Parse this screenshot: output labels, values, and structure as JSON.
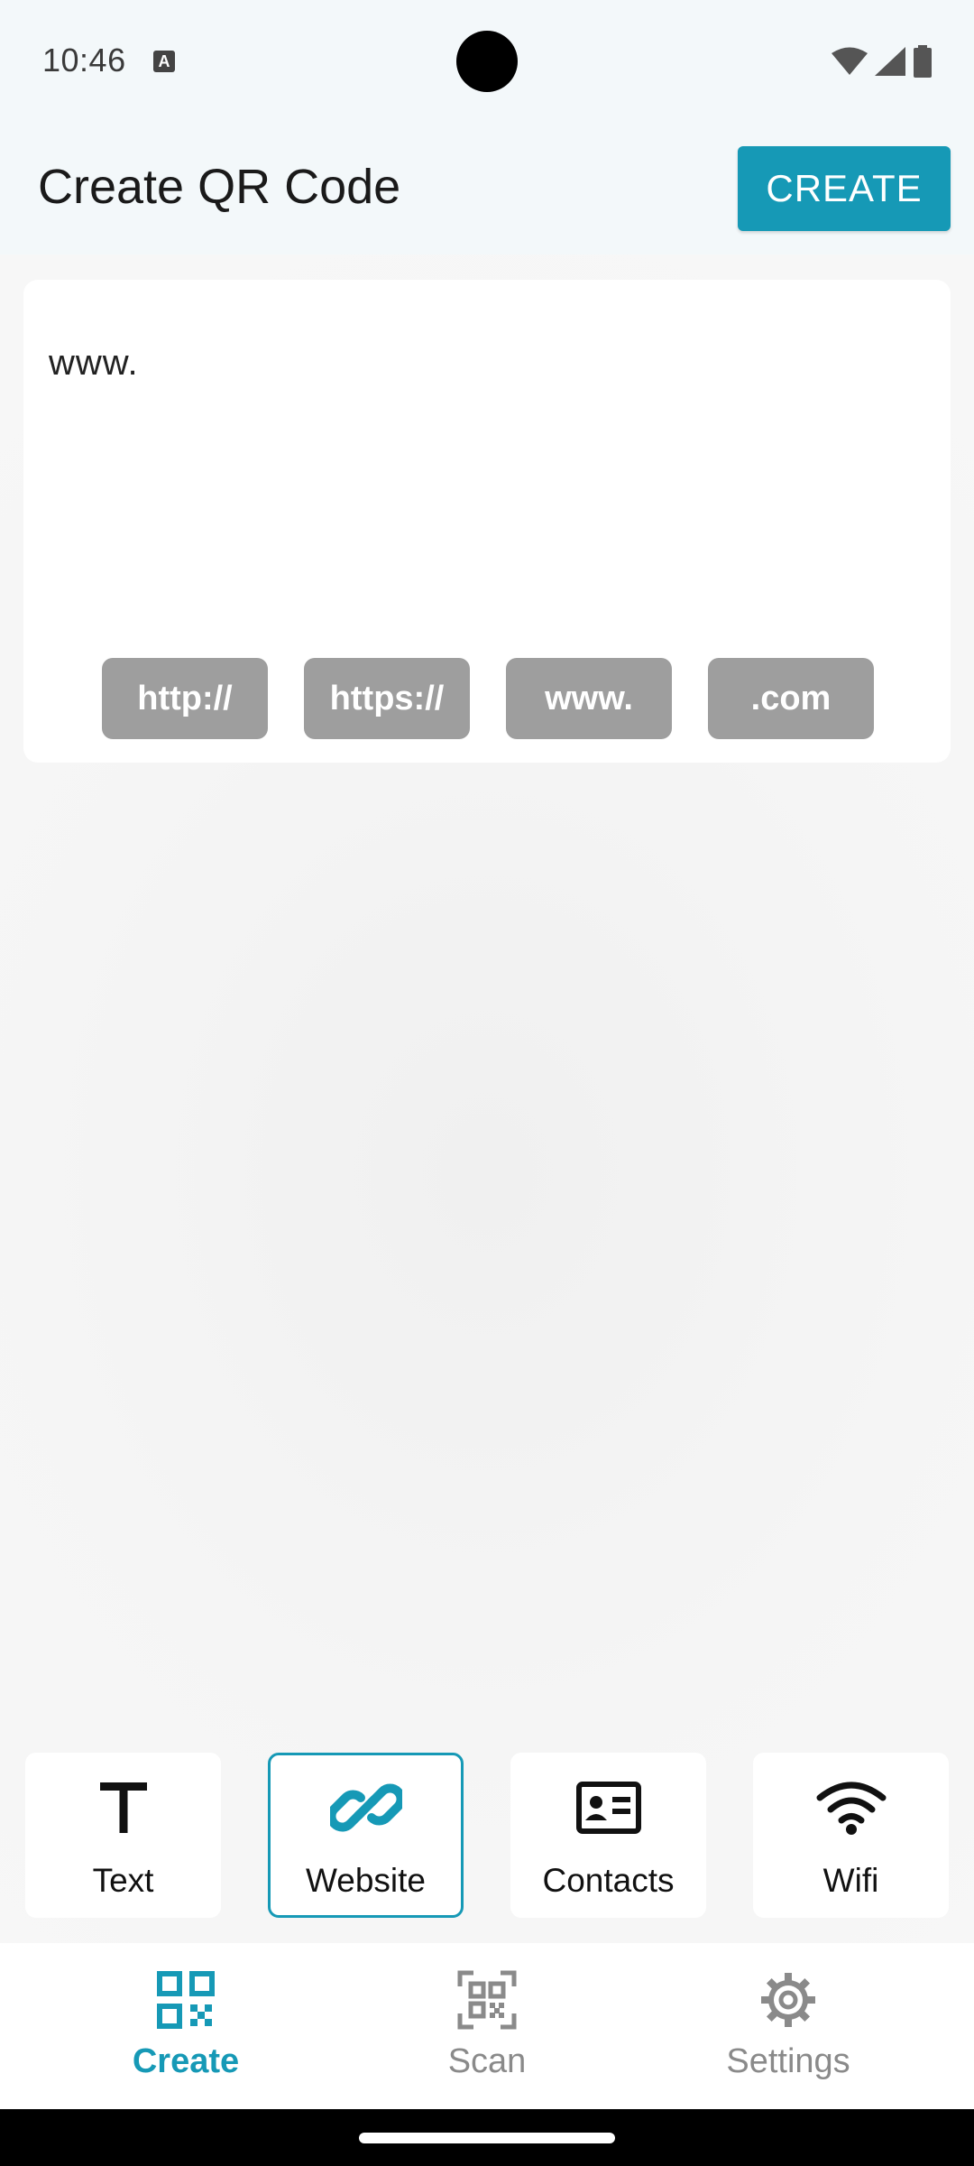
{
  "status_bar": {
    "time": "10:46",
    "notification_icon": "A"
  },
  "app_bar": {
    "title": "Create QR Code",
    "create_label": "CREATE"
  },
  "input": {
    "value": "www."
  },
  "quick_inserts": [
    {
      "label": "http://"
    },
    {
      "label": "https://"
    },
    {
      "label": "www."
    },
    {
      "label": ".com"
    }
  ],
  "types": [
    {
      "label": "Text",
      "icon": "text-icon",
      "selected": false
    },
    {
      "label": "Website",
      "icon": "link-icon",
      "selected": true
    },
    {
      "label": "Contacts",
      "icon": "contact-card-icon",
      "selected": false
    },
    {
      "label": "Wifi",
      "icon": "wifi-icon",
      "selected": false
    }
  ],
  "bottom_nav": [
    {
      "label": "Create",
      "icon": "qr-code-icon",
      "active": true
    },
    {
      "label": "Scan",
      "icon": "qr-scan-icon",
      "active": false
    },
    {
      "label": "Settings",
      "icon": "gear-icon",
      "active": false
    }
  ],
  "colors": {
    "accent": "#1699b6",
    "chip": "#9e9e9e",
    "inactive_nav": "#8a8a8a"
  }
}
